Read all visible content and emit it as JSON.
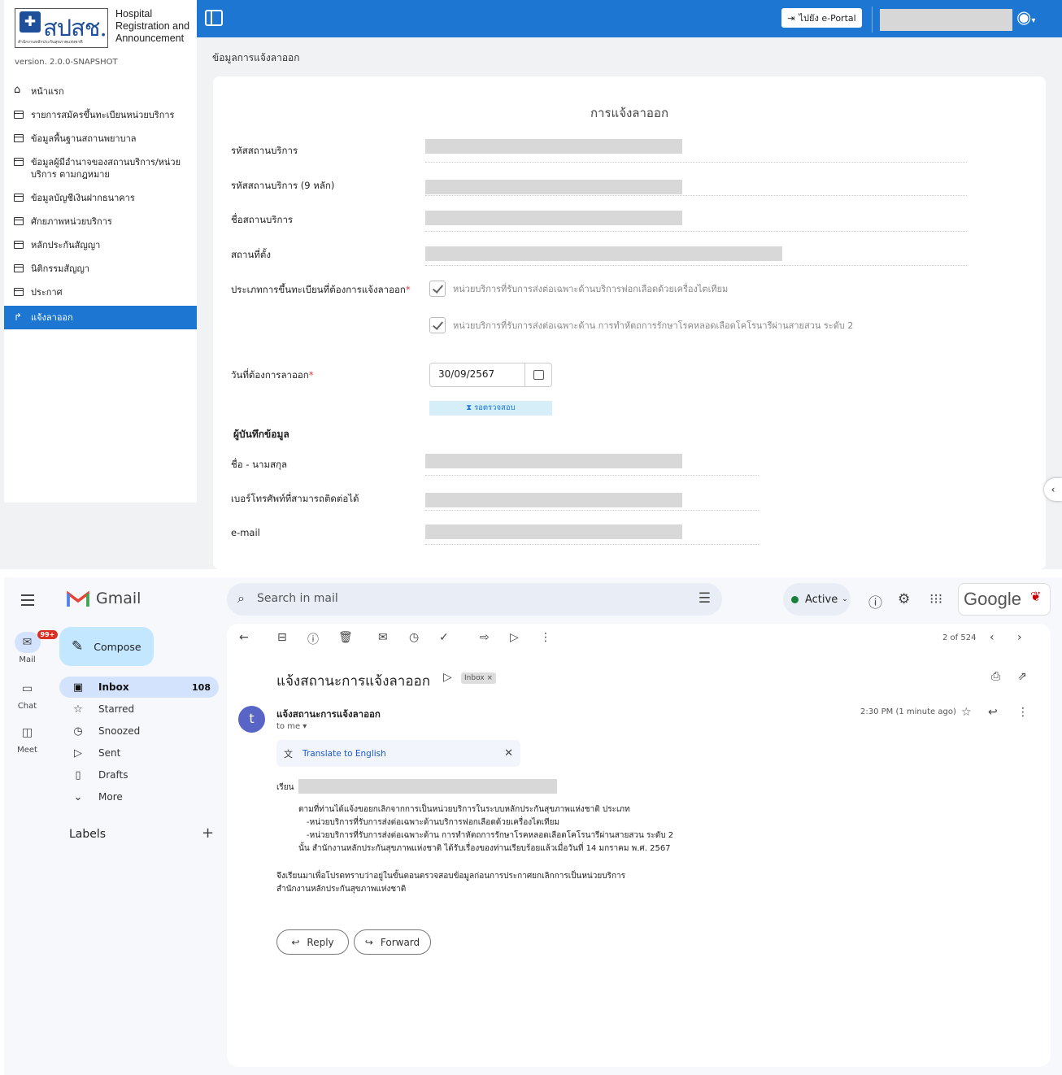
{
  "app": {
    "brand_mark": "สปสช.",
    "brand_sub": "สำนักงานหลักประกันสุขภาพแห่งชาติ",
    "brand_title": "Hospital Registration and Announcement",
    "version": "version. 2.0.0-SNAPSHOT"
  },
  "sidebar": {
    "items": [
      {
        "label": "หน้าแรก",
        "icon": "home-icon"
      },
      {
        "label": "รายการสมัครขึ้นทะเบียนหน่วยบริการ",
        "icon": "window-icon"
      },
      {
        "label": "ข้อมูลพื้นฐานสถานพยาบาล",
        "icon": "window-icon"
      },
      {
        "label": "ข้อมูลผู้มีอำนาจของสถานบริการ/หน่วยบริการ ตามกฎหมาย",
        "icon": "window-icon"
      },
      {
        "label": "ข้อมูลบัญชีเงินฝากธนาคาร",
        "icon": "window-icon"
      },
      {
        "label": "ศักยภาพหน่วยบริการ",
        "icon": "window-icon"
      },
      {
        "label": "หลักประกันสัญญา",
        "icon": "window-icon"
      },
      {
        "label": "นิติกรรมสัญญา",
        "icon": "window-icon"
      },
      {
        "label": "ประกาศ",
        "icon": "window-icon"
      },
      {
        "label": "แจ้งลาออก",
        "icon": "arrow-icon",
        "active": true
      }
    ]
  },
  "header": {
    "eportal": "ไปยัง e-Portal",
    "accent": "#1c76d2"
  },
  "breadcrumb": "ข้อมูลการแจ้งลาออก",
  "form": {
    "title": "การแจ้งลาออก",
    "fields": [
      "รหัสสถานบริการ",
      "รหัสสถานบริการ (9 หลัก)",
      "ชื่อสถานบริการ",
      "สถานที่ตั้ง"
    ],
    "type_label": "ประเภทการขึ้นทะเบียนที่ต้องการแจ้งลาออก",
    "options": [
      "หน่วยบริการที่รับการส่งต่อเฉพาะด้านบริการฟอกเลือดด้วยเครื่องไตเทียม",
      "หน่วยบริการที่รับการส่งต่อเฉพาะด้าน การทำหัตถการรักษาโรคหลอดเลือดโคโรนารีผ่านสายสวน ระดับ 2"
    ],
    "date_label": "วันที่ต้องการลาออก",
    "date_value": "30/09/2567",
    "status": "⧗ รอตรวจสอบ",
    "recorder_title": "ผู้บันทึกข้อมูล",
    "recorder_fields": [
      "ชื่อ - นามสกุล",
      "เบอร์โทรศัพท์ที่สามารถติดต่อได้",
      "e-mail"
    ],
    "required_mark": "*"
  },
  "gmail": {
    "app_name": "Gmail",
    "search_placeholder": "Search in mail",
    "status": "Active",
    "google": "Google",
    "rail": [
      {
        "label": "Mail",
        "badge": "99+"
      },
      {
        "label": "Chat"
      },
      {
        "label": "Meet"
      }
    ],
    "compose": "Compose",
    "folders": [
      {
        "label": "Inbox",
        "count": "108",
        "icon": "inbox-icon"
      },
      {
        "label": "Starred",
        "icon": "star-icon"
      },
      {
        "label": "Snoozed",
        "icon": "clock-icon"
      },
      {
        "label": "Sent",
        "icon": "send-icon"
      },
      {
        "label": "Drafts",
        "icon": "draft-icon"
      },
      {
        "label": "More",
        "icon": "chevron-down-icon"
      }
    ],
    "labels_title": "Labels",
    "pager": "2 of 524",
    "subject": "แจ้งสถานะการแจ้งลาออก",
    "inbox_chip": "Inbox ×",
    "sender": "แจ้งสถานะการแจ้งลาออก",
    "avatar": "t",
    "to_me": "to me ▾",
    "time": "2:30 PM (1 minute ago)",
    "translate": "Translate to English",
    "body": {
      "greeting": "เรียน",
      "lines": [
        "ตามที่ท่านได้แจ้งขอยกเลิกจากการเป็นหน่วยบริการในระบบหลักประกันสุขภาพแห่งชาติ ประเภท",
        "-หน่วยบริการที่รับการส่งต่อเฉพาะด้านบริการฟอกเลือดด้วยเครื่องไตเทียม",
        "-หน่วยบริการที่รับการส่งต่อเฉพาะด้าน การทำหัตถการรักษาโรคหลอดเลือดโคโรนารีผ่านสายสวน ระดับ 2",
        "นั้น สำนักงานหลักประกันสุขภาพแห่งชาติ ได้รับเรื่องของท่านเรียบร้อยแล้วเมื่อวันที่ 14 มกราคม พ.ศ. 2567"
      ],
      "closing": [
        "จึงเรียนมาเพื่อโปรดทราบว่าอยู่ในขั้นตอนตรวจสอบข้อมูลก่อนการประกาศยกเลิกการเป็นหน่วยบริการ",
        "สำนักงานหลักประกันสุขภาพแห่งชาติ"
      ]
    },
    "reply": "Reply",
    "forward": "Forward"
  }
}
